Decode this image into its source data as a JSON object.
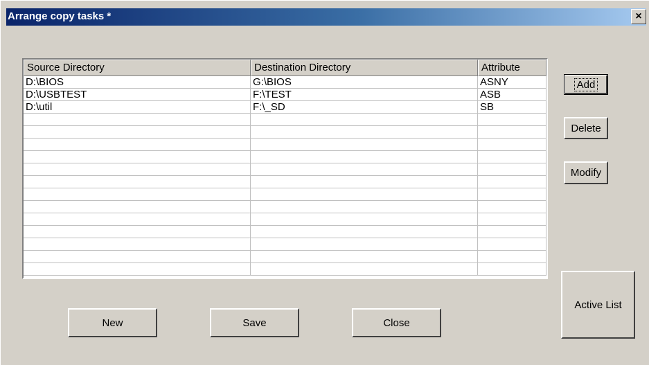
{
  "window": {
    "title": "Arrange copy tasks *",
    "close_glyph": "×"
  },
  "list": {
    "columns": [
      "Source Directory",
      "Destination Directory",
      "Attribute"
    ],
    "rows": [
      [
        "D:\\BIOS",
        "G:\\BIOS",
        "ASNY"
      ],
      [
        "D:\\USBTEST",
        "F:\\TEST",
        "ASB"
      ],
      [
        "D:\\util",
        "F:\\_SD",
        "SB"
      ],
      [
        "",
        "",
        ""
      ],
      [
        "",
        "",
        ""
      ],
      [
        "",
        "",
        ""
      ],
      [
        "",
        "",
        ""
      ],
      [
        "",
        "",
        ""
      ],
      [
        "",
        "",
        ""
      ],
      [
        "",
        "",
        ""
      ],
      [
        "",
        "",
        ""
      ],
      [
        "",
        "",
        ""
      ],
      [
        "",
        "",
        ""
      ],
      [
        "",
        "",
        ""
      ],
      [
        "",
        "",
        ""
      ],
      [
        "",
        "",
        ""
      ]
    ]
  },
  "buttons": {
    "add": "Add",
    "delete": "Delete",
    "modify": "Modify",
    "active_list": "Active List",
    "new": "New",
    "save": "Save",
    "close": "Close"
  }
}
